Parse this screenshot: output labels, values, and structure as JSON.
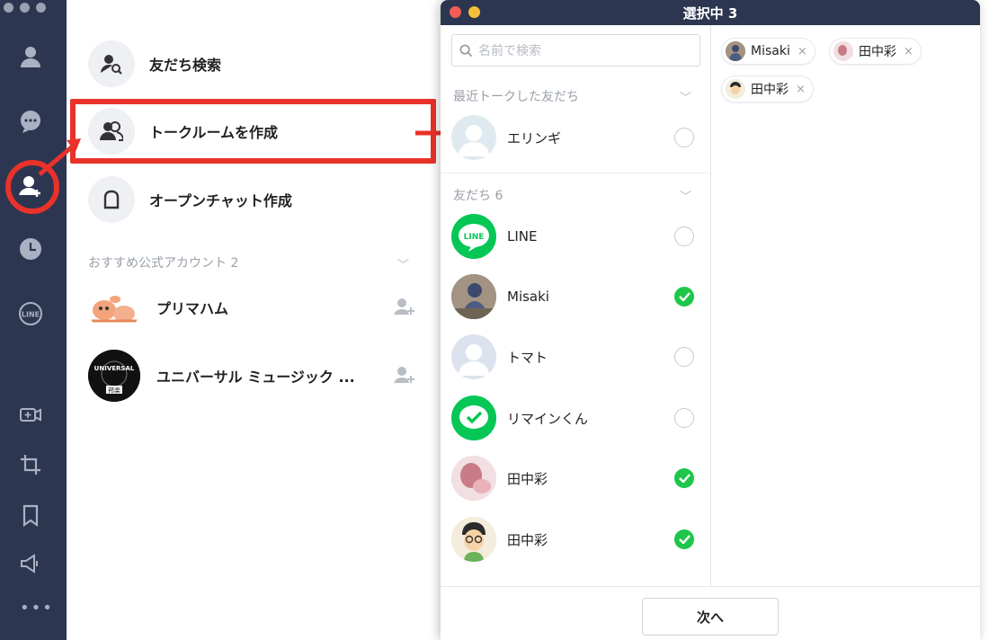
{
  "rail": {
    "icons": [
      "friends-icon",
      "chats-icon",
      "add-friend-icon",
      "recent-icon",
      "line-icon",
      "video-call-icon",
      "crop-icon",
      "bookmark-icon",
      "announce-icon"
    ],
    "more_label": "•••"
  },
  "menu": {
    "items": [
      {
        "label": "友だち検索",
        "icon": "friend-search-icon"
      },
      {
        "label": "トークルームを作成",
        "icon": "group-icon"
      },
      {
        "label": "オープンチャット作成",
        "icon": "open-chat-icon"
      }
    ],
    "section_label": "おすすめ公式アカウント 2",
    "official_accounts": [
      {
        "name": "プリマハム"
      },
      {
        "name": "ユニバーサル ミュージック ..."
      }
    ],
    "universal_logo_text": "UNIVERSAL",
    "universal_badge_text": "邦楽"
  },
  "dialog": {
    "title": "選択中 3",
    "search_placeholder": "名前で検索",
    "recent_group_label": "最近トークした友だち",
    "friends_group_label": "友だち 6",
    "recent": [
      {
        "name": "エリンギ",
        "checked": false
      }
    ],
    "friends": [
      {
        "name": "LINE",
        "checked": false
      },
      {
        "name": "Misaki",
        "checked": true
      },
      {
        "name": "トマト",
        "checked": false
      },
      {
        "name": "リマインくん",
        "checked": false
      },
      {
        "name": "田中彩",
        "checked": true
      },
      {
        "name": "田中彩",
        "checked": true
      }
    ],
    "selected": [
      {
        "name": "Misaki",
        "remove": "×"
      },
      {
        "name": "田中彩",
        "remove": "×"
      },
      {
        "name": "田中彩",
        "remove": "×"
      }
    ],
    "line_logo_text": "LINE",
    "rail_line_logo_text": "LINE",
    "next_label": "次へ"
  },
  "colors": {
    "rail": "#2d3650",
    "highlight": "#e8322a",
    "check": "#1ec74a",
    "close_red": "#f25c54",
    "minimize_yellow": "#f6bf3a"
  }
}
